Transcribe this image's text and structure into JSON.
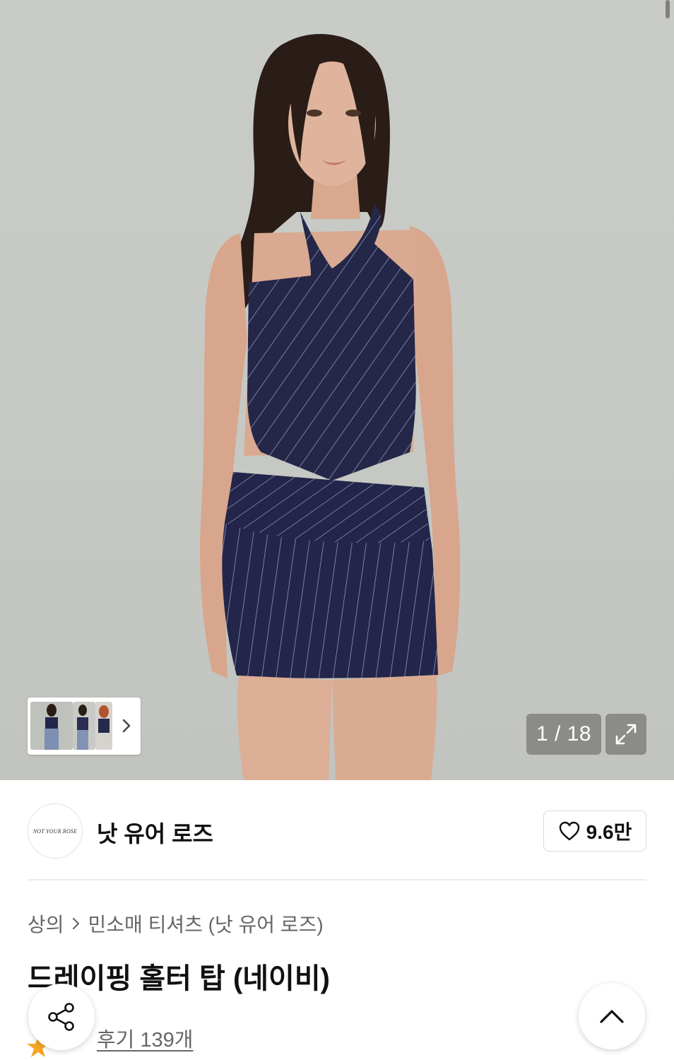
{
  "gallery": {
    "counter": "1 / 18",
    "expand_icon": "expand-icon",
    "thumbnail_next_icon": "chevron-right-icon"
  },
  "brand": {
    "logo_text": "NOT YOUR ROSE",
    "name": "낫 유어 로즈",
    "like_count": "9.6만",
    "like_icon": "heart-outline-icon"
  },
  "breadcrumb": {
    "category": "상의",
    "subcategory": "민소매 티셔츠 (낫 유어 로즈)"
  },
  "product": {
    "title": "드레이핑 홀터 탑 (네이비)",
    "reviews": "후기 139개"
  },
  "floating": {
    "share_icon": "share-icon",
    "scroll_top_icon": "chevron-up-icon"
  },
  "colors": {
    "navy": "#23264a",
    "background": "#c7c9c5",
    "accent_star": "#f5a623"
  }
}
